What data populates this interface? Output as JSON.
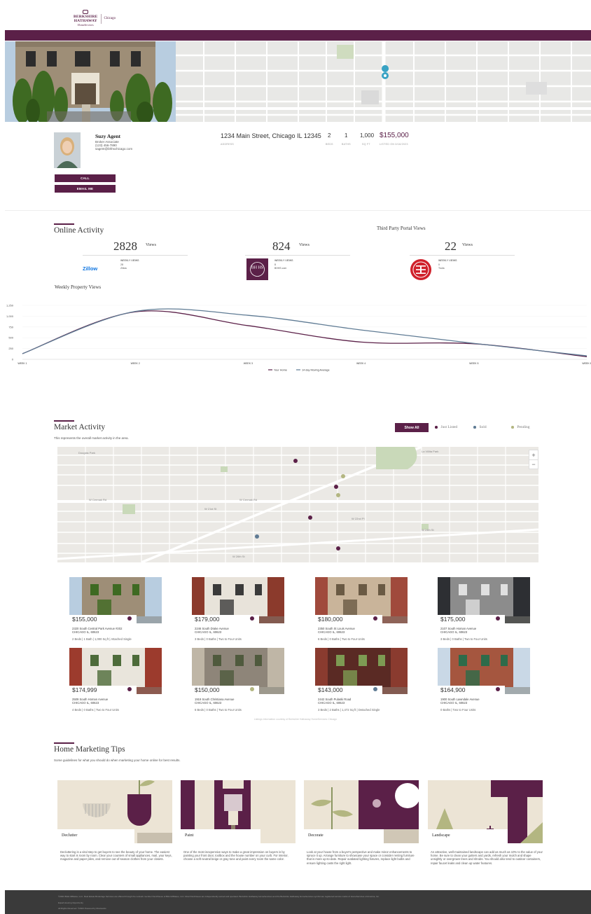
{
  "header": {
    "logo_line1": "BERKSHIRE",
    "logo_line2": "HATHAWAY",
    "logo_line3": "HomeServices",
    "logo_city": "Chicago"
  },
  "agent": {
    "name": "Suzy Agent",
    "title": "Broker Associate",
    "phone": "(123) 456-7890",
    "email": "sagent@bhhschicago.com",
    "call_label": "CALL",
    "email_label": "EMAIL ME"
  },
  "property": {
    "address": "1234 Main Street, Chicago IL 12345",
    "address_label": "ADDRESS",
    "beds": "2",
    "beds_label": "BEDS",
    "baths": "1",
    "baths_label": "BATHS",
    "sqft": "1,000",
    "sqft_label": "SQ FT",
    "price": "$155,000",
    "price_label": "LISTED ON 6/16/2023"
  },
  "online_activity": {
    "title": "Online Activity",
    "third_party_title": "Third Party Portal Views",
    "weekly_label": "WEEKLY VIEWS",
    "portals": [
      {
        "views": "2828",
        "views_label": "Views",
        "weekly": "28",
        "source": "Zillow",
        "logo_text": "Zillow"
      },
      {
        "views": "824",
        "views_label": "Views",
        "weekly": "8",
        "source": "BHHS.com",
        "logo_text": "BH HS"
      },
      {
        "views": "22",
        "views_label": "Views",
        "weekly": "0",
        "source": "Trulia"
      }
    ],
    "chart_title": "Weekly Property Views"
  },
  "chart_data": {
    "type": "line",
    "title": "Weekly Property Views",
    "categories": [
      "WEEK 1",
      "WEEK 2",
      "WEEK 3",
      "WEEK 4",
      "WEEK 5",
      "WEEK 6"
    ],
    "ylim": [
      0,
      1250
    ],
    "yticks": [
      "0",
      "250",
      "500",
      "750",
      "1,000",
      "1,250"
    ],
    "series": [
      {
        "name": "Your Home",
        "color": "#5b2048",
        "values": [
          130,
          1100,
          780,
          400,
          360,
          60
        ]
      },
      {
        "name": "14 day Moving Average",
        "color": "#5f7b94",
        "values": [
          130,
          1110,
          1020,
          680,
          370,
          80
        ]
      }
    ],
    "legend": "bottom-center"
  },
  "market_activity": {
    "title": "Market Activity",
    "subtitle": "This represents the overall market activity in the area.",
    "show_all": "Show All",
    "legend": [
      {
        "label": "Just Listed",
        "color": "#5b2048"
      },
      {
        "label": "Sold",
        "color": "#5f7b94"
      },
      {
        "label": "Pending",
        "color": "#b3b681"
      }
    ],
    "map_labels": [
      "W Cermak Rd",
      "W 21st St",
      "W 22nd Pl",
      "W 24th St",
      "W 26th St",
      "W 28th St",
      "Douglas Park",
      "W 31st St",
      "La Villita Park"
    ],
    "zoom_in": "+",
    "zoom_out": "−",
    "listings": [
      {
        "price": "$155,000",
        "addr1": "2320 South Central Park Avenue #202",
        "addr2": "CHICAGO IL, 60623",
        "specs": "2 Beds | 1 Bath | 1,000 Sq ft | Attached Single",
        "status_color": "#5b2048"
      },
      {
        "price": "$179,000",
        "addr1": "2246 South Drake Avenue",
        "addr2": "CHICAGO IL, 60623",
        "specs": "3 Beds | 0 Baths | Two to Four Units",
        "status_color": "#5b2048"
      },
      {
        "price": "$180,000",
        "addr1": "2350 South St Louis Avenue",
        "addr2": "CHICAGO IL, 60623",
        "specs": "6 Beds | 0 Baths | Two to Four Units",
        "status_color": "#5b2048"
      },
      {
        "price": "$175,000",
        "addr1": "2107 South Homan Avenue",
        "addr2": "CHICAGO IL, 60623",
        "specs": "3 Beds | 0 Baths | Two to Four Units",
        "status_color": "#5b2048"
      },
      {
        "price": "$174,999",
        "addr1": "2509 South Homan Avenue",
        "addr2": "CHICAGO IL, 60623",
        "specs": "4 Beds | 0 Baths | Two to Four Units",
        "status_color": "#5b2048"
      },
      {
        "price": "$150,000",
        "addr1": "1919 South Christiana Avenue",
        "addr2": "CHICAGO IL, 60623",
        "specs": "6 Beds | 0 Baths | Two to Four Units",
        "status_color": "#b3b681"
      },
      {
        "price": "$143,000",
        "addr1": "2442 South Pulaski Road",
        "addr2": "CHICAGO IL, 60623",
        "specs": "3 Beds | 2 Baths | 1,472 Sq ft | Detached Single",
        "status_color": "#5f7b94"
      },
      {
        "price": "$164,900",
        "addr1": "1900 South Lawndale Avenue",
        "addr2": "CHICAGO IL, 60623",
        "specs": "0 Baths | Two to Four Units",
        "status_color": "#5b2048"
      }
    ],
    "footnote": "Listings information courtesy of Berkshire Hathaway HomeServices Chicago"
  },
  "tips": {
    "title": "Home Marketing Tips",
    "subtitle": "Some guidelines for what you should do when marketing your home online for best results.",
    "items": [
      {
        "title": "Declutter",
        "desc": "Decluttering is a vital step to get buyers to see the beauty of your home. The easiest way to start is room by room. Clear your counters of small appliances, mail, your keys, magazine and paper piles, and remove out-of-season clothes from your closets."
      },
      {
        "title": "Paint",
        "desc": "One of the most inexpensive ways to make a great impression on buyers is by painting your front door, toolbox and the house number on your curb. For interior, choose a soft neutral beige or gray tone and paint every room the same color."
      },
      {
        "title": "Decorate",
        "desc": "Look at your house from a buyer's perspective and make minor enhancements to spruce it up. Arrange furniture to showcase your space or consider renting furniture that is more up-to-date. Repair outdated lighting fixtures, replace light bulbs and ensure lighting casts the right light."
      },
      {
        "title": "Landscape",
        "desc": "An attractive, well-maintained landscape can add as much as 10% to the value of your home. Be sure to clean your gutters and yards, refresh your mulch and shape unsightly or overgrown trees and shrubs. You should also tend to outdoor containers, repair faucet leaks and clean up water features."
      }
    ]
  },
  "footer": {
    "line1": "©2023 BHH Affiliates, LLC. Real Estate Brokerage Services are offered through the network member franchisees of BHH Affiliates, LLC. Most franchisees are independently owned and operated. Berkshire Hathaway HomeServices and the Berkshire Hathaway HomeServices symbol are registered service marks of HomeServices of America, Inc.",
    "line2": "Equal Housing Opportunity",
    "line3": "All Rights Reserved. ©2023 Powered by Moxiworks"
  }
}
